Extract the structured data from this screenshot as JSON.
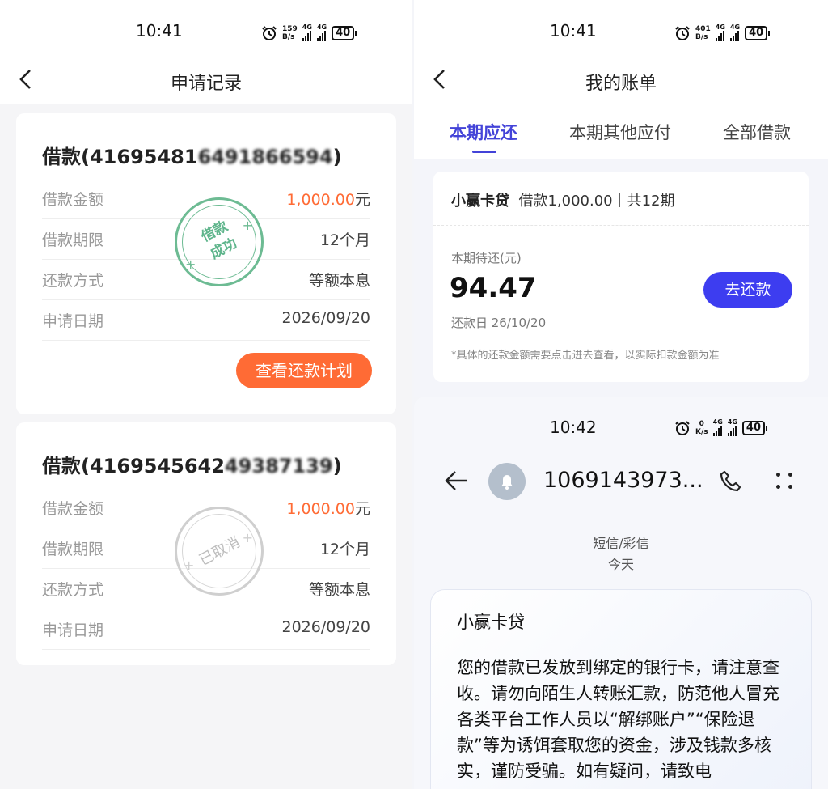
{
  "left": {
    "status_time": "10:41",
    "speed": [
      "159",
      "B/s"
    ],
    "battery": "40",
    "title": "申请记录",
    "records": [
      {
        "title_prefix": "借款(41695481",
        "title_masked": "6491866594",
        "title_suffix": ")",
        "rows": [
          {
            "label": "借款金额",
            "value": "1,000.00",
            "unit": "元"
          },
          {
            "label": "借款期限",
            "value": "12个月"
          },
          {
            "label": "还款方式",
            "value": "等额本息"
          },
          {
            "label": "申请日期",
            "value": "2026/09/20"
          }
        ],
        "stamp": "借款成功",
        "stamp_line1": "借款",
        "stamp_line2": "成功",
        "button": "查看还款计划"
      },
      {
        "title_prefix": "借款(4169545642",
        "title_masked": "49387139",
        "title_suffix": ")",
        "rows": [
          {
            "label": "借款金额",
            "value": "1,000.00",
            "unit": "元"
          },
          {
            "label": "借款期限",
            "value": "12个月"
          },
          {
            "label": "还款方式",
            "value": "等额本息"
          },
          {
            "label": "申请日期",
            "value": "2026/09/20"
          }
        ],
        "stamp": "已取消"
      }
    ]
  },
  "right": {
    "status_time": "10:41",
    "speed": [
      "401",
      "B/s"
    ],
    "battery": "40",
    "title": "我的账单",
    "tabs": [
      "本期应还",
      "本期其他应付",
      "全部借款"
    ],
    "active_tab": 0,
    "bill": {
      "lender": "小赢卡贷",
      "summary": "借款1,000.00｜共12期",
      "due_label": "本期待还(元)",
      "amount": "94.47",
      "due_date": "还款日 26/10/20",
      "pay_button": "去还款",
      "note": "*具体的还款金额需要点击进去查看，以实际扣款金额为准"
    }
  },
  "sms": {
    "status_time": "10:42",
    "speed": [
      "0",
      "K/s"
    ],
    "battery": "40",
    "sender": "1069143973...",
    "category": "短信/彩信",
    "day": "今天",
    "message_title": "小赢卡贷",
    "message_body": "您的借款已发放到绑定的银行卡，请注意查收。请勿向陌生人转账汇款，防范他人冒充各类平台工作人员以“解绑账户”“保险退款”等为诱饵套取您的资金，涉及钱款多核实，谨防受骗。如有疑问，请致电"
  },
  "colors": {
    "accent_orange": "#FF6B35",
    "accent_blue": "#3D3DF0",
    "tab_active": "#4343D8",
    "stamp_green": "#5FB58C",
    "stamp_gray": "#C8C8C8"
  },
  "icons": [
    "back-arrow-icon",
    "alarm-icon",
    "signal-icon",
    "battery-icon",
    "bell-avatar-icon",
    "phone-icon",
    "more-icon"
  ]
}
